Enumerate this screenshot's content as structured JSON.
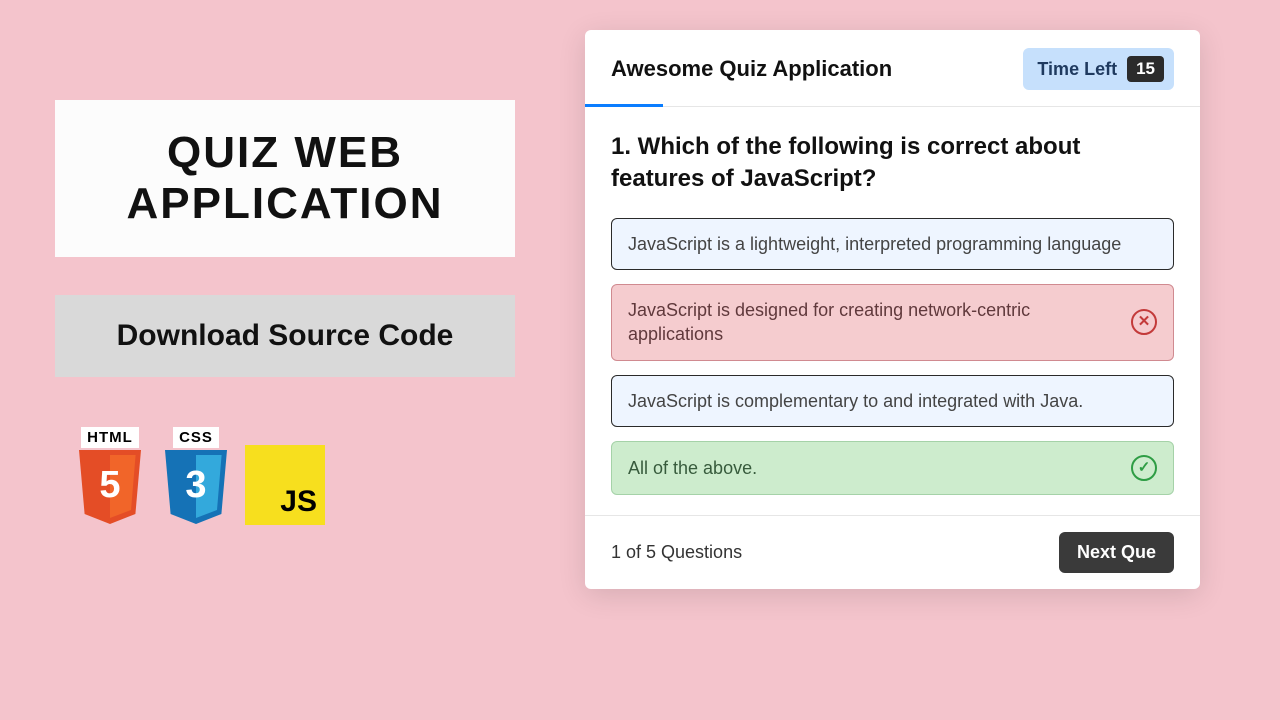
{
  "left": {
    "title_line1": "QUIZ  WEB",
    "title_line2": "APPLICATION",
    "download_label": "Download Source Code",
    "badges": {
      "html_label": "HTML",
      "html_num": "5",
      "html_color": "#e44d26",
      "css_label": "CSS",
      "css_num": "3",
      "css_color": "#1572b6",
      "js_label": "JS",
      "js_color": "#f7df1e"
    }
  },
  "quiz": {
    "app_title": "Awesome Quiz Application",
    "timer_label": "Time Left",
    "timer_value": "15",
    "question": "1. Which of the following is correct about features of JavaScript?",
    "options": [
      {
        "text": "JavaScript is a lightweight, interpreted programming language",
        "state": "neutral"
      },
      {
        "text": "JavaScript is designed for creating network-centric applications",
        "state": "wrong"
      },
      {
        "text": "JavaScript is complementary to and integrated with Java.",
        "state": "neutral"
      },
      {
        "text": "All of the above.",
        "state": "correct"
      }
    ],
    "counter": "1 of 5 Questions",
    "next_label": "Next Que"
  }
}
